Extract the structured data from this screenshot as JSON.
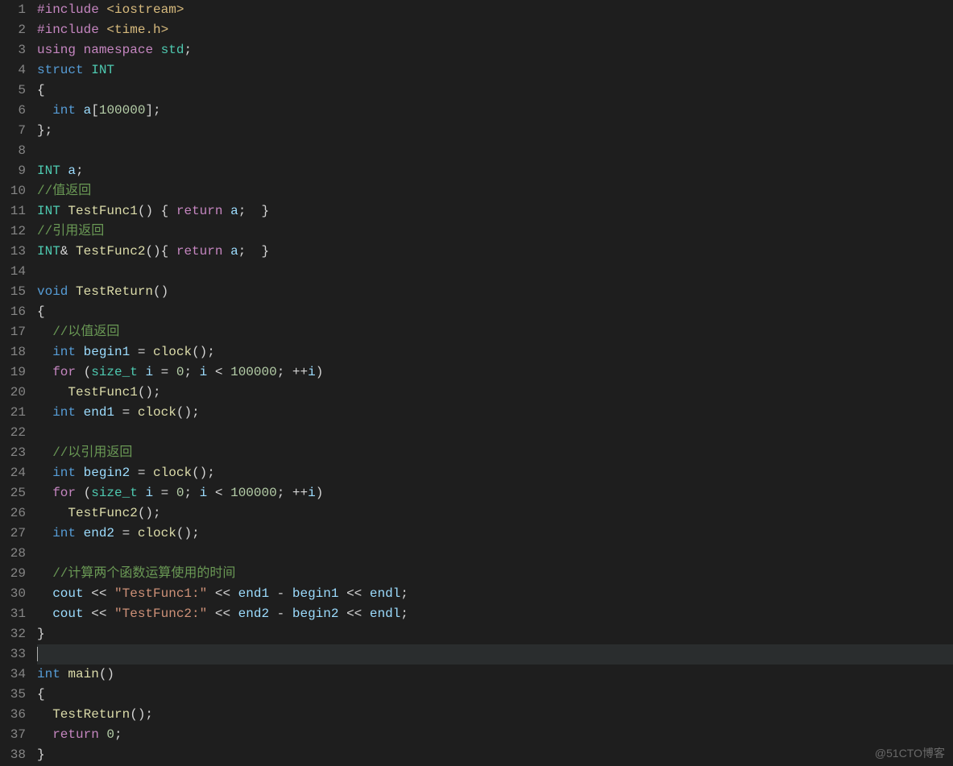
{
  "watermark": "@51CTO博客",
  "highlight_line": 33,
  "lines": [
    {
      "n": 1,
      "tokens": [
        {
          "cls": "pp",
          "t": "#include"
        },
        {
          "cls": "punc",
          "t": " "
        },
        {
          "cls": "inc",
          "t": "<iostream>"
        }
      ]
    },
    {
      "n": 2,
      "tokens": [
        {
          "cls": "pp",
          "t": "#include"
        },
        {
          "cls": "punc",
          "t": " "
        },
        {
          "cls": "inc",
          "t": "<time.h>"
        }
      ]
    },
    {
      "n": 3,
      "tokens": [
        {
          "cls": "kw",
          "t": "using"
        },
        {
          "cls": "punc",
          "t": " "
        },
        {
          "cls": "kw",
          "t": "namespace"
        },
        {
          "cls": "punc",
          "t": " "
        },
        {
          "cls": "ns",
          "t": "std"
        },
        {
          "cls": "punc",
          "t": ";"
        }
      ]
    },
    {
      "n": 4,
      "tokens": [
        {
          "cls": "kwty",
          "t": "struct"
        },
        {
          "cls": "punc",
          "t": " "
        },
        {
          "cls": "ns",
          "t": "INT"
        }
      ]
    },
    {
      "n": 5,
      "tokens": [
        {
          "cls": "punc",
          "t": "{"
        }
      ]
    },
    {
      "n": 6,
      "tokens": [
        {
          "cls": "punc",
          "t": "  "
        },
        {
          "cls": "kwty",
          "t": "int"
        },
        {
          "cls": "punc",
          "t": " "
        },
        {
          "cls": "var",
          "t": "a"
        },
        {
          "cls": "punc",
          "t": "["
        },
        {
          "cls": "num",
          "t": "100000"
        },
        {
          "cls": "punc",
          "t": "];"
        }
      ]
    },
    {
      "n": 7,
      "tokens": [
        {
          "cls": "punc",
          "t": "};"
        }
      ]
    },
    {
      "n": 8,
      "tokens": []
    },
    {
      "n": 9,
      "tokens": [
        {
          "cls": "ns",
          "t": "INT"
        },
        {
          "cls": "punc",
          "t": " "
        },
        {
          "cls": "var",
          "t": "a"
        },
        {
          "cls": "punc",
          "t": ";"
        }
      ]
    },
    {
      "n": 10,
      "tokens": [
        {
          "cls": "cmt",
          "t": "//值返回"
        }
      ]
    },
    {
      "n": 11,
      "tokens": [
        {
          "cls": "ns",
          "t": "INT"
        },
        {
          "cls": "punc",
          "t": " "
        },
        {
          "cls": "fn",
          "t": "TestFunc1"
        },
        {
          "cls": "punc",
          "t": "() { "
        },
        {
          "cls": "kw",
          "t": "return"
        },
        {
          "cls": "punc",
          "t": " "
        },
        {
          "cls": "var",
          "t": "a"
        },
        {
          "cls": "punc",
          "t": ";  }"
        }
      ]
    },
    {
      "n": 12,
      "tokens": [
        {
          "cls": "cmt",
          "t": "//引用返回"
        }
      ]
    },
    {
      "n": 13,
      "tokens": [
        {
          "cls": "ns",
          "t": "INT"
        },
        {
          "cls": "punc",
          "t": "& "
        },
        {
          "cls": "fn",
          "t": "TestFunc2"
        },
        {
          "cls": "punc",
          "t": "(){ "
        },
        {
          "cls": "kw",
          "t": "return"
        },
        {
          "cls": "punc",
          "t": " "
        },
        {
          "cls": "var",
          "t": "a"
        },
        {
          "cls": "punc",
          "t": ";  }"
        }
      ]
    },
    {
      "n": 14,
      "tokens": []
    },
    {
      "n": 15,
      "tokens": [
        {
          "cls": "kwty",
          "t": "void"
        },
        {
          "cls": "punc",
          "t": " "
        },
        {
          "cls": "fn",
          "t": "TestReturn"
        },
        {
          "cls": "punc",
          "t": "()"
        }
      ]
    },
    {
      "n": 16,
      "tokens": [
        {
          "cls": "punc",
          "t": "{"
        }
      ]
    },
    {
      "n": 17,
      "tokens": [
        {
          "cls": "punc",
          "t": "  "
        },
        {
          "cls": "cmt",
          "t": "//以值返回"
        }
      ]
    },
    {
      "n": 18,
      "tokens": [
        {
          "cls": "punc",
          "t": "  "
        },
        {
          "cls": "kwty",
          "t": "int"
        },
        {
          "cls": "punc",
          "t": " "
        },
        {
          "cls": "var",
          "t": "begin1"
        },
        {
          "cls": "punc",
          "t": " = "
        },
        {
          "cls": "fn",
          "t": "clock"
        },
        {
          "cls": "punc",
          "t": "();"
        }
      ]
    },
    {
      "n": 19,
      "tokens": [
        {
          "cls": "punc",
          "t": "  "
        },
        {
          "cls": "kw",
          "t": "for"
        },
        {
          "cls": "punc",
          "t": " ("
        },
        {
          "cls": "ns",
          "t": "size_t"
        },
        {
          "cls": "punc",
          "t": " "
        },
        {
          "cls": "var",
          "t": "i"
        },
        {
          "cls": "punc",
          "t": " = "
        },
        {
          "cls": "num",
          "t": "0"
        },
        {
          "cls": "punc",
          "t": "; "
        },
        {
          "cls": "var",
          "t": "i"
        },
        {
          "cls": "punc",
          "t": " < "
        },
        {
          "cls": "num",
          "t": "100000"
        },
        {
          "cls": "punc",
          "t": "; ++"
        },
        {
          "cls": "var",
          "t": "i"
        },
        {
          "cls": "punc",
          "t": ")"
        }
      ]
    },
    {
      "n": 20,
      "tokens": [
        {
          "cls": "punc",
          "t": "    "
        },
        {
          "cls": "fn",
          "t": "TestFunc1"
        },
        {
          "cls": "punc",
          "t": "();"
        }
      ]
    },
    {
      "n": 21,
      "tokens": [
        {
          "cls": "punc",
          "t": "  "
        },
        {
          "cls": "kwty",
          "t": "int"
        },
        {
          "cls": "punc",
          "t": " "
        },
        {
          "cls": "var",
          "t": "end1"
        },
        {
          "cls": "punc",
          "t": " = "
        },
        {
          "cls": "fn",
          "t": "clock"
        },
        {
          "cls": "punc",
          "t": "();"
        }
      ]
    },
    {
      "n": 22,
      "tokens": []
    },
    {
      "n": 23,
      "tokens": [
        {
          "cls": "punc",
          "t": "  "
        },
        {
          "cls": "cmt",
          "t": "//以引用返回"
        }
      ]
    },
    {
      "n": 24,
      "tokens": [
        {
          "cls": "punc",
          "t": "  "
        },
        {
          "cls": "kwty",
          "t": "int"
        },
        {
          "cls": "punc",
          "t": " "
        },
        {
          "cls": "var",
          "t": "begin2"
        },
        {
          "cls": "punc",
          "t": " = "
        },
        {
          "cls": "fn",
          "t": "clock"
        },
        {
          "cls": "punc",
          "t": "();"
        }
      ]
    },
    {
      "n": 25,
      "tokens": [
        {
          "cls": "punc",
          "t": "  "
        },
        {
          "cls": "kw",
          "t": "for"
        },
        {
          "cls": "punc",
          "t": " ("
        },
        {
          "cls": "ns",
          "t": "size_t"
        },
        {
          "cls": "punc",
          "t": " "
        },
        {
          "cls": "var",
          "t": "i"
        },
        {
          "cls": "punc",
          "t": " = "
        },
        {
          "cls": "num",
          "t": "0"
        },
        {
          "cls": "punc",
          "t": "; "
        },
        {
          "cls": "var",
          "t": "i"
        },
        {
          "cls": "punc",
          "t": " < "
        },
        {
          "cls": "num",
          "t": "100000"
        },
        {
          "cls": "punc",
          "t": "; ++"
        },
        {
          "cls": "var",
          "t": "i"
        },
        {
          "cls": "punc",
          "t": ")"
        }
      ]
    },
    {
      "n": 26,
      "tokens": [
        {
          "cls": "punc",
          "t": "    "
        },
        {
          "cls": "fn",
          "t": "TestFunc2"
        },
        {
          "cls": "punc",
          "t": "();"
        }
      ]
    },
    {
      "n": 27,
      "tokens": [
        {
          "cls": "punc",
          "t": "  "
        },
        {
          "cls": "kwty",
          "t": "int"
        },
        {
          "cls": "punc",
          "t": " "
        },
        {
          "cls": "var",
          "t": "end2"
        },
        {
          "cls": "punc",
          "t": " = "
        },
        {
          "cls": "fn",
          "t": "clock"
        },
        {
          "cls": "punc",
          "t": "();"
        }
      ]
    },
    {
      "n": 28,
      "tokens": []
    },
    {
      "n": 29,
      "tokens": [
        {
          "cls": "punc",
          "t": "  "
        },
        {
          "cls": "cmt",
          "t": "//计算两个函数运算使用的时间"
        }
      ]
    },
    {
      "n": 30,
      "tokens": [
        {
          "cls": "punc",
          "t": "  "
        },
        {
          "cls": "var",
          "t": "cout"
        },
        {
          "cls": "punc",
          "t": " << "
        },
        {
          "cls": "str",
          "t": "\"TestFunc1:\""
        },
        {
          "cls": "punc",
          "t": " << "
        },
        {
          "cls": "var",
          "t": "end1"
        },
        {
          "cls": "punc",
          "t": " - "
        },
        {
          "cls": "var",
          "t": "begin1"
        },
        {
          "cls": "punc",
          "t": " << "
        },
        {
          "cls": "var",
          "t": "endl"
        },
        {
          "cls": "punc",
          "t": ";"
        }
      ]
    },
    {
      "n": 31,
      "tokens": [
        {
          "cls": "punc",
          "t": "  "
        },
        {
          "cls": "var",
          "t": "cout"
        },
        {
          "cls": "punc",
          "t": " << "
        },
        {
          "cls": "str",
          "t": "\"TestFunc2:\""
        },
        {
          "cls": "punc",
          "t": " << "
        },
        {
          "cls": "var",
          "t": "end2"
        },
        {
          "cls": "punc",
          "t": " - "
        },
        {
          "cls": "var",
          "t": "begin2"
        },
        {
          "cls": "punc",
          "t": " << "
        },
        {
          "cls": "var",
          "t": "endl"
        },
        {
          "cls": "punc",
          "t": ";"
        }
      ]
    },
    {
      "n": 32,
      "tokens": [
        {
          "cls": "punc",
          "t": "}"
        }
      ]
    },
    {
      "n": 33,
      "cursor": true,
      "tokens": []
    },
    {
      "n": 34,
      "tokens": [
        {
          "cls": "kwty",
          "t": "int"
        },
        {
          "cls": "punc",
          "t": " "
        },
        {
          "cls": "fn",
          "t": "main"
        },
        {
          "cls": "punc",
          "t": "()"
        }
      ]
    },
    {
      "n": 35,
      "tokens": [
        {
          "cls": "punc",
          "t": "{"
        }
      ]
    },
    {
      "n": 36,
      "tokens": [
        {
          "cls": "punc",
          "t": "  "
        },
        {
          "cls": "fn",
          "t": "TestReturn"
        },
        {
          "cls": "punc",
          "t": "();"
        }
      ]
    },
    {
      "n": 37,
      "tokens": [
        {
          "cls": "punc",
          "t": "  "
        },
        {
          "cls": "kw",
          "t": "return"
        },
        {
          "cls": "punc",
          "t": " "
        },
        {
          "cls": "num",
          "t": "0"
        },
        {
          "cls": "punc",
          "t": ";"
        }
      ]
    },
    {
      "n": 38,
      "tokens": [
        {
          "cls": "punc",
          "t": "}"
        }
      ]
    }
  ]
}
